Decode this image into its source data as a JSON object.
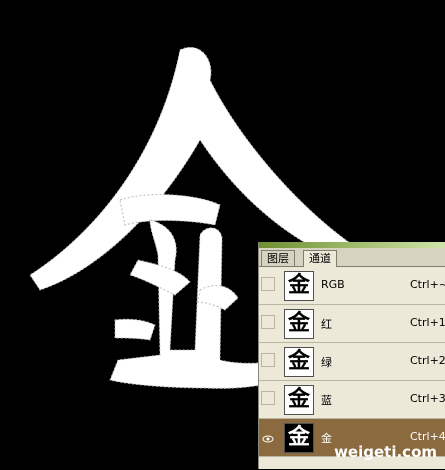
{
  "panel": {
    "tabs": [
      {
        "label": "图层",
        "active": false
      },
      {
        "label": "通道",
        "active": true
      }
    ],
    "channels": [
      {
        "thumb_char": "金",
        "name": "RGB",
        "shortcut": "Ctrl+~",
        "visible": false,
        "selected": false
      },
      {
        "thumb_char": "金",
        "name": "红",
        "shortcut": "Ctrl+1",
        "visible": false,
        "selected": false
      },
      {
        "thumb_char": "金",
        "name": "绿",
        "shortcut": "Ctrl+2",
        "visible": false,
        "selected": false
      },
      {
        "thumb_char": "金",
        "name": "蓝",
        "shortcut": "Ctrl+3",
        "visible": false,
        "selected": false
      },
      {
        "thumb_char": "金",
        "name": "金",
        "shortcut": "Ctrl+4",
        "visible": true,
        "selected": true
      }
    ]
  },
  "watermark": "weigeti.com"
}
